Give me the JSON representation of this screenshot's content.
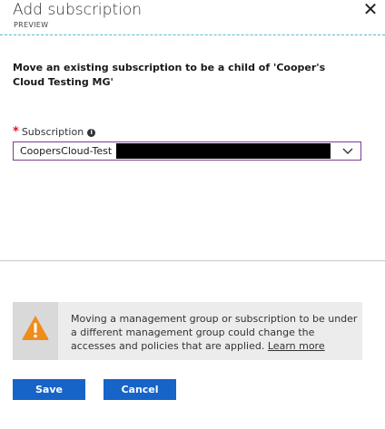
{
  "header": {
    "title": "Add subscription",
    "subtitle": "PREVIEW",
    "close_glyph": "✕"
  },
  "description": "Move an existing subscription to be a child of 'Cooper's Cloud Testing MG'",
  "subscription_field": {
    "required_marker": "*",
    "label": "Subscription",
    "info_glyph": "i",
    "selected_value": "CoopersCloud-Test"
  },
  "warning": {
    "text": "Moving a management group or subscription to be under a different management group could change the accesses and policies that are applied.",
    "link_label": "Learn more",
    "icon": "warning-triangle-icon"
  },
  "buttons": {
    "save_label": "Save",
    "cancel_label": "Cancel"
  },
  "colors": {
    "accent": "#1664c8",
    "select_border": "#7a3c95",
    "required": "#e81123",
    "warning_icon": "#f08c1c",
    "header_divider": "#5bb5d4"
  }
}
